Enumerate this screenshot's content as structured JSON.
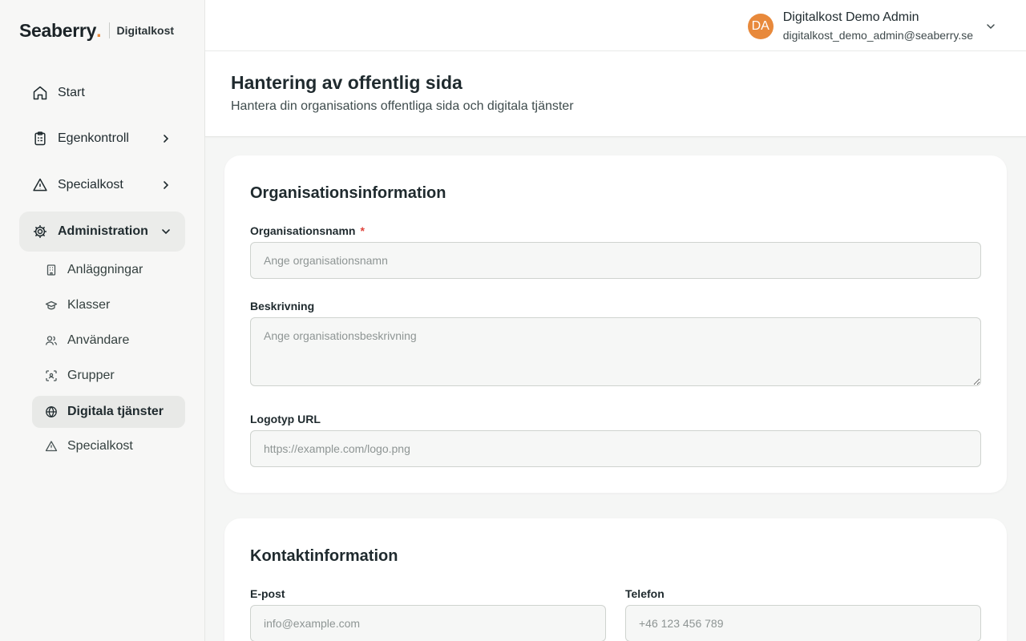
{
  "brand": {
    "name": "Seaberry",
    "dot": ".",
    "product": "Digitalkost"
  },
  "nav": {
    "start": "Start",
    "egenkontroll": "Egenkontroll",
    "specialkost": "Specialkost",
    "administration": "Administration",
    "sub": {
      "anlaggningar": "Anläggningar",
      "klasser": "Klasser",
      "anvandare": "Användare",
      "grupper": "Grupper",
      "digitala": "Digitala tjänster",
      "specialkost": "Specialkost"
    }
  },
  "user": {
    "initials": "DA",
    "name": "Digitalkost Demo Admin",
    "email": "digitalkost_demo_admin@seaberry.se"
  },
  "page": {
    "title": "Hantering av offentlig sida",
    "subtitle": "Hantera din organisations offentliga sida och digitala tjänster"
  },
  "org": {
    "title": "Organisationsinformation",
    "name_label": "Organisationsnamn",
    "required_mark": "*",
    "name_placeholder": "Ange organisationsnamn",
    "desc_label": "Beskrivning",
    "desc_placeholder": "Ange organisationsbeskrivning",
    "logo_label": "Logotyp URL",
    "logo_placeholder": "https://example.com/logo.png"
  },
  "contact": {
    "title": "Kontaktinformation",
    "email_label": "E-post",
    "email_placeholder": "info@example.com",
    "phone_label": "Telefon",
    "phone_placeholder": "+46 123 456 789"
  },
  "colors": {
    "accent": "#e8893b",
    "required": "#e0443c"
  }
}
